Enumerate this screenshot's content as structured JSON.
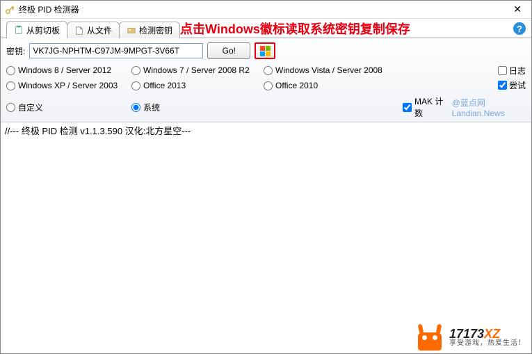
{
  "window": {
    "title": "终极 PID 检测器"
  },
  "annotation": "点击Windows徽标读取系统密钥复制保存",
  "tabs": {
    "t1": "从剪切板",
    "t2": "从文件",
    "t3": "检测密钥"
  },
  "key": {
    "label": "密钥:",
    "value": "VK7JG-NPHTM-C97JM-9MPGT-3V66T",
    "go": "Go!"
  },
  "radios": {
    "r1": "Windows 8 / Server 2012",
    "r2": "Windows 7 / Server 2008 R2",
    "r3": "Windows Vista / Server 2008",
    "r4": "Windows XP / Server 2003",
    "r5": "Office 2013",
    "r6": "Office 2010",
    "r7": "自定义",
    "r8": "系统"
  },
  "checks": {
    "log": "日志",
    "try": "尝试",
    "mak": "MAK 计数"
  },
  "watermark": "@蓝点网 Landian.News",
  "output": "//--- 终极 PID 检测 v1.1.3.590 汉化:北方星空---",
  "footer": {
    "brand1": "17173",
    "brand2": "XZ",
    "slogan": "享受游戏，热爱生活！"
  }
}
